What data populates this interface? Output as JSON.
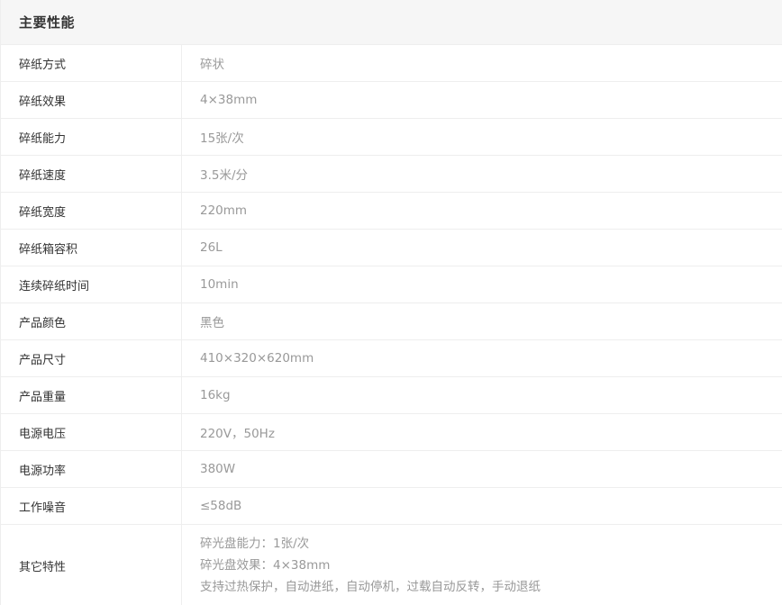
{
  "section": {
    "title": "主要性能"
  },
  "specs": [
    {
      "label": "碎纸方式",
      "value": "碎状"
    },
    {
      "label": "碎纸效果",
      "value": "4×38mm"
    },
    {
      "label": "碎纸能力",
      "value": "15张/次"
    },
    {
      "label": "碎纸速度",
      "value": "3.5米/分"
    },
    {
      "label": "碎纸宽度",
      "value": "220mm"
    },
    {
      "label": "碎纸箱容积",
      "value": "26L"
    },
    {
      "label": "连续碎纸时间",
      "value": "10min"
    },
    {
      "label": "产品颜色",
      "value": "黑色"
    },
    {
      "label": "产品尺寸",
      "value": "410×320×620mm"
    },
    {
      "label": "产品重量",
      "value": "16kg"
    },
    {
      "label": "电源电压",
      "value": "220V，50Hz"
    },
    {
      "label": "电源功率",
      "value": "380W"
    },
    {
      "label": "工作噪音",
      "value": "≤58dB"
    }
  ],
  "other": {
    "label": "其它特性",
    "lines": [
      "碎光盘能力：1张/次",
      "碎光盘效果：4×38mm",
      "支持过热保护，自动进纸，自动停机，过载自动反转，手动退纸"
    ]
  }
}
